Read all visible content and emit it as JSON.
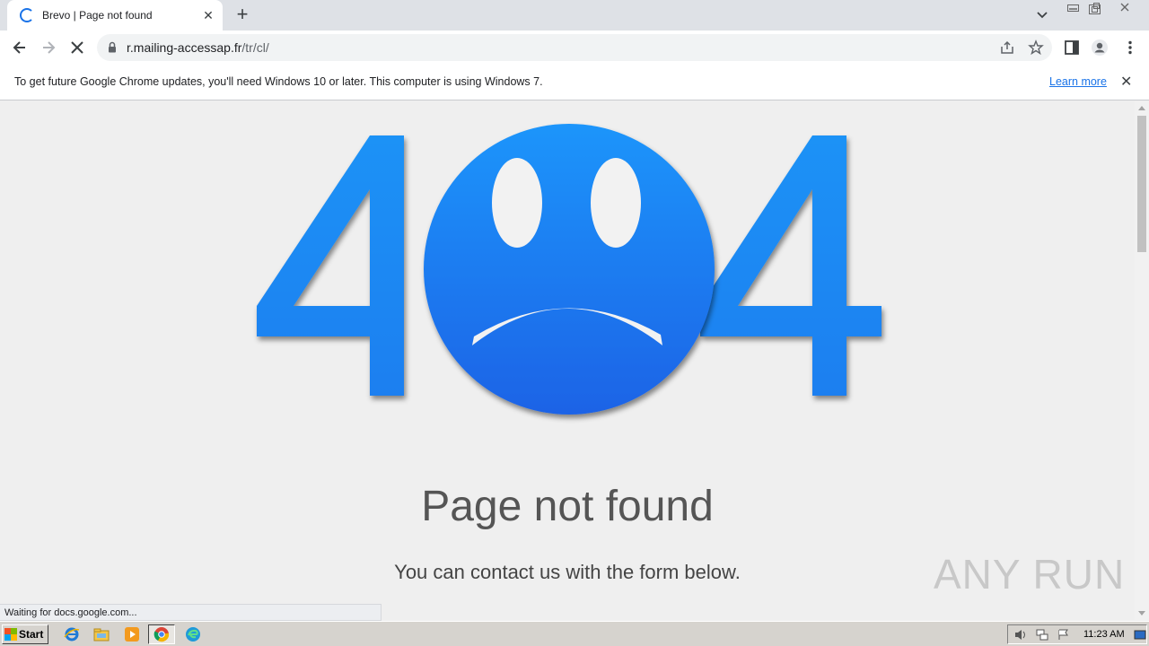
{
  "tab": {
    "title": "Brevo | Page not found",
    "close": "✕"
  },
  "newtab": "+",
  "omnibox": {
    "domain": "r.mailing-accessap.fr",
    "path": "/tr/cl/"
  },
  "infobar": {
    "message": "To get future Google Chrome updates, you'll need Windows 10 or later. This computer is using Windows 7.",
    "link": "Learn more",
    "close": "✕"
  },
  "page": {
    "heading": "Page not found",
    "subtext": "You can contact us with the form below.",
    "art": {
      "left_digit": "4",
      "right_digit": "4",
      "accent": "#1f8ef7"
    }
  },
  "status": "Waiting for docs.google.com...",
  "watermark": "ANY RUN",
  "taskbar": {
    "start": "Start",
    "clock": "11:23 AM",
    "apps": [
      "ie-icon",
      "explorer-icon",
      "media-player-icon",
      "chrome-icon",
      "edge-icon"
    ]
  },
  "colors": {
    "link": "#1a73e8",
    "tabstrip": "#dee1e6",
    "page_bg": "#efefef",
    "taskbar": "#d6d3ce"
  }
}
